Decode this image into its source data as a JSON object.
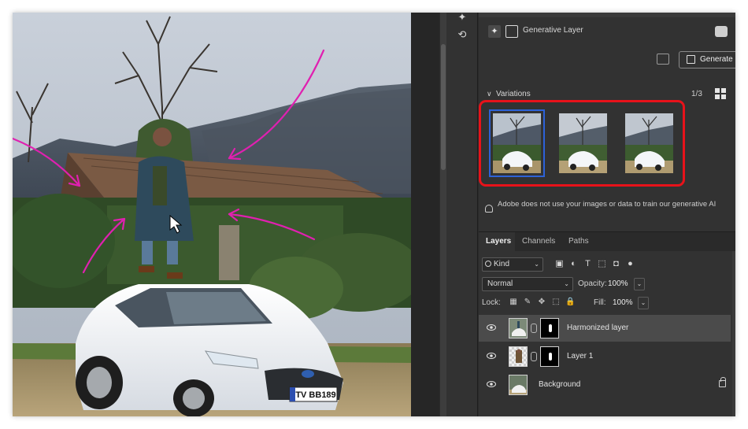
{
  "properties": {
    "layer_type_label": "Generative Layer",
    "generate_button_label": "Generate",
    "variations_label": "Variations",
    "variations_count": "1/3",
    "selected_variation": 1,
    "variations": [
      "variation-1",
      "variation-2",
      "variation-3"
    ],
    "ai_notice": "Adobe does not use your images or data to train our generative AI"
  },
  "layers_panel": {
    "tabs": [
      "Layers",
      "Channels",
      "Paths"
    ],
    "active_tab": "Layers",
    "filter_kind": "Kind",
    "blend_mode": "Normal",
    "opacity_label": "Opacity:",
    "opacity_value": "100%",
    "lock_label": "Lock:",
    "fill_label": "Fill:",
    "fill_value": "100%",
    "layers": [
      {
        "name": "Harmonized layer",
        "visible": true,
        "selected": true,
        "has_mask": true
      },
      {
        "name": "Layer 1",
        "visible": true,
        "selected": false,
        "has_mask": true
      },
      {
        "name": "Background",
        "visible": true,
        "selected": false,
        "has_mask": false,
        "locked": true
      }
    ]
  },
  "canvas": {
    "license_plate": "TV BB189",
    "annotation_color": "#e020b0"
  },
  "colors": {
    "highlight_box": "#e8121a",
    "selected_outline": "#2d62d8",
    "panel_bg": "#323232"
  }
}
